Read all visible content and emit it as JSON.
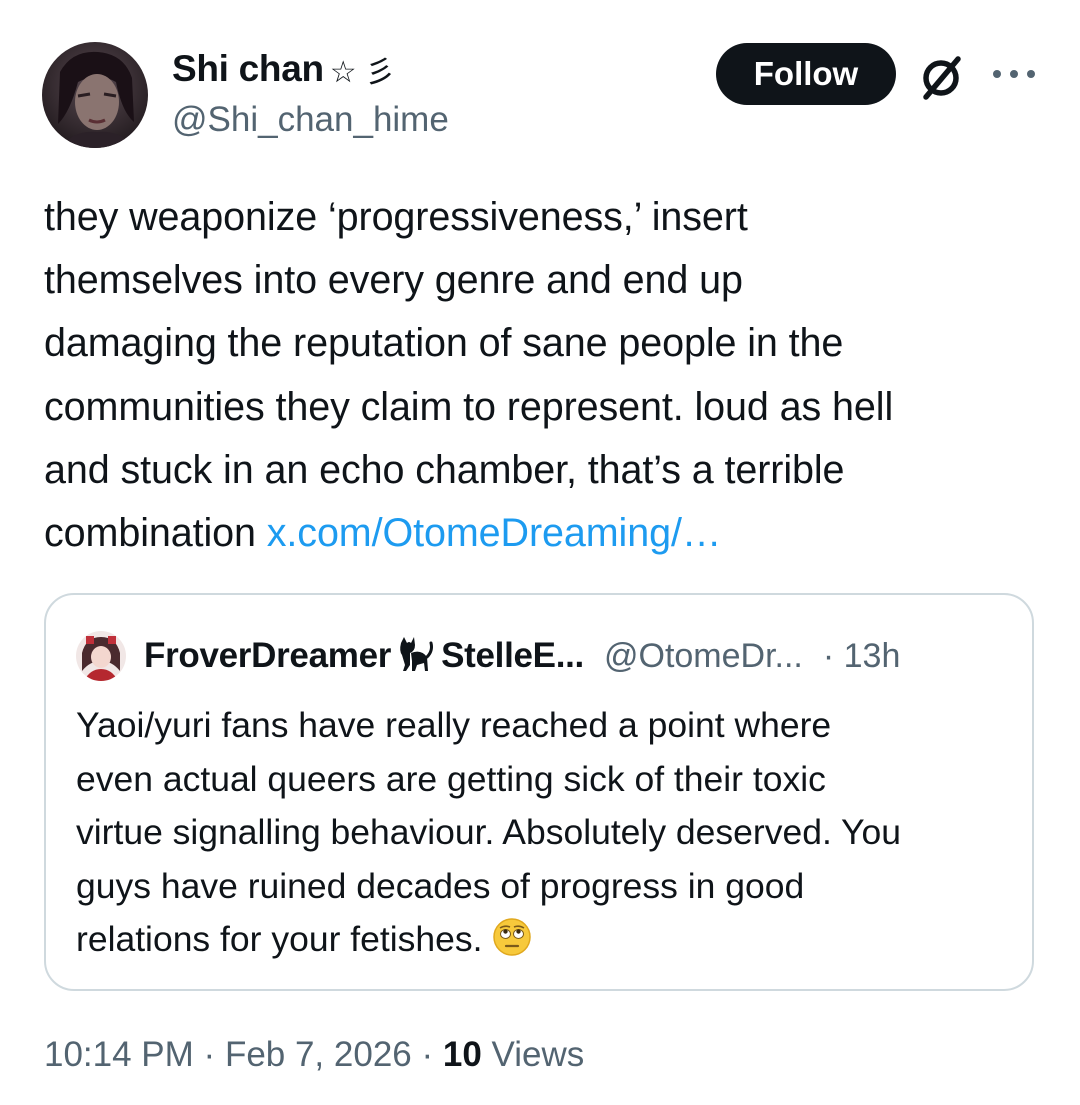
{
  "author": {
    "display_name": "Shi chan",
    "name_decoration": "☆ 彡",
    "handle": "@Shi_chan_hime",
    "avatar_icon": "user-avatar"
  },
  "actions": {
    "follow_label": "Follow",
    "grok_icon": "grok-icon",
    "more_icon": "more-options-icon"
  },
  "tweet": {
    "text": "they weaponize ‘progressiveness,’ insert\nthemselves into every genre and end up\ndamaging the reputation of sane people in the\ncommunities they claim to represent. loud as hell\nand stuck in an echo chamber, that’s a terrible\ncombination ",
    "link_text": "x.com/OtomeDreaming/…",
    "link_color": "#1d9bf0"
  },
  "quote": {
    "display_name": "FroverDreamer",
    "name_icon": "black-cat-emoji",
    "name_suffix": "StelleE...",
    "handle": "@OtomeDr...",
    "time": "· 13h",
    "text": "Yaoi/yuri fans have really reached a point where\neven actual queers are getting sick of their toxic\nvirtue signalling behaviour. Absolutely deserved. You\nguys have ruined decades of progress in good\nrelations for your fetishes. ",
    "emoji": "face-with-rolling-eyes-emoji"
  },
  "meta": {
    "time": "10:14 PM",
    "date": "Feb 7, 2026",
    "separator": "·",
    "views_count": "10",
    "views_label": "Views"
  },
  "colors": {
    "text": "#0f1419",
    "secondary": "#536471",
    "border": "#cfd9de",
    "button_bg": "#0f1419"
  }
}
